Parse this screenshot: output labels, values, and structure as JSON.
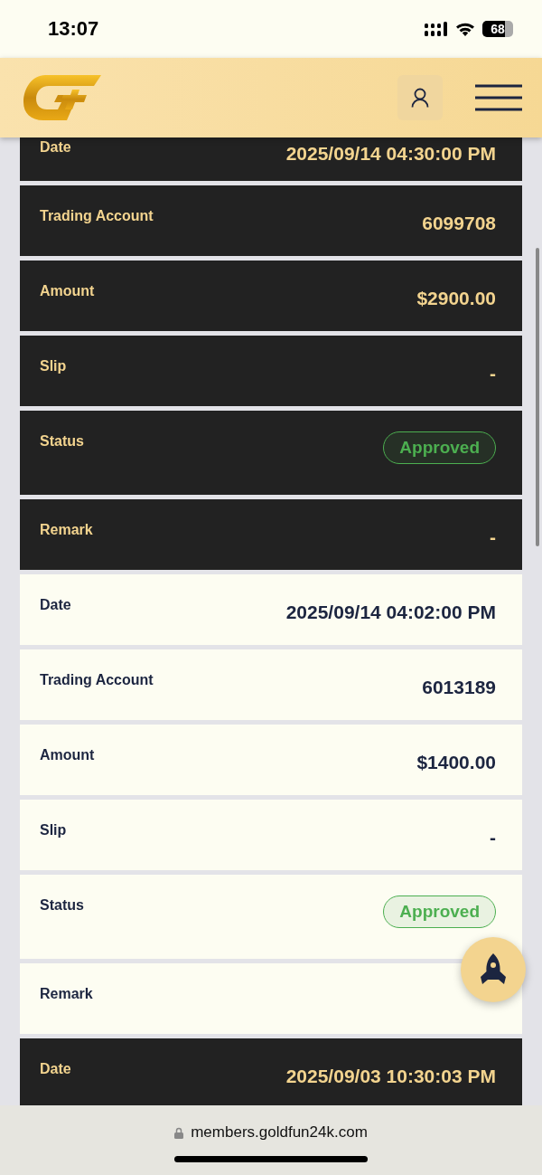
{
  "status_bar": {
    "time": "13:07",
    "battery": "68"
  },
  "records": [
    {
      "kind": "dark",
      "fields": [
        {
          "kind": "text",
          "label": "Date",
          "value": "2025/09/14 04:30:00 PM"
        },
        {
          "kind": "text",
          "label": "Trading Account",
          "value": "6099708"
        },
        {
          "kind": "text",
          "label": "Amount",
          "value": "$2900.00"
        },
        {
          "kind": "text",
          "label": "Slip",
          "value": "-"
        },
        {
          "kind": "badge",
          "label": "Status",
          "value": "Approved"
        },
        {
          "kind": "text",
          "label": "Remark",
          "value": "-"
        }
      ]
    },
    {
      "kind": "light",
      "fields": [
        {
          "kind": "text",
          "label": "Date",
          "value": "2025/09/14 04:02:00 PM"
        },
        {
          "kind": "text",
          "label": "Trading Account",
          "value": "6013189"
        },
        {
          "kind": "text",
          "label": "Amount",
          "value": "$1400.00"
        },
        {
          "kind": "text",
          "label": "Slip",
          "value": "-"
        },
        {
          "kind": "badge",
          "label": "Status",
          "value": "Approved"
        },
        {
          "kind": "text",
          "label": "Remark"
        }
      ]
    },
    {
      "kind": "dark",
      "fields": [
        {
          "kind": "text",
          "label": "Date",
          "value": "2025/09/03 10:30:03 PM"
        }
      ]
    }
  ],
  "browser": {
    "url": "members.goldfun24k.com"
  }
}
